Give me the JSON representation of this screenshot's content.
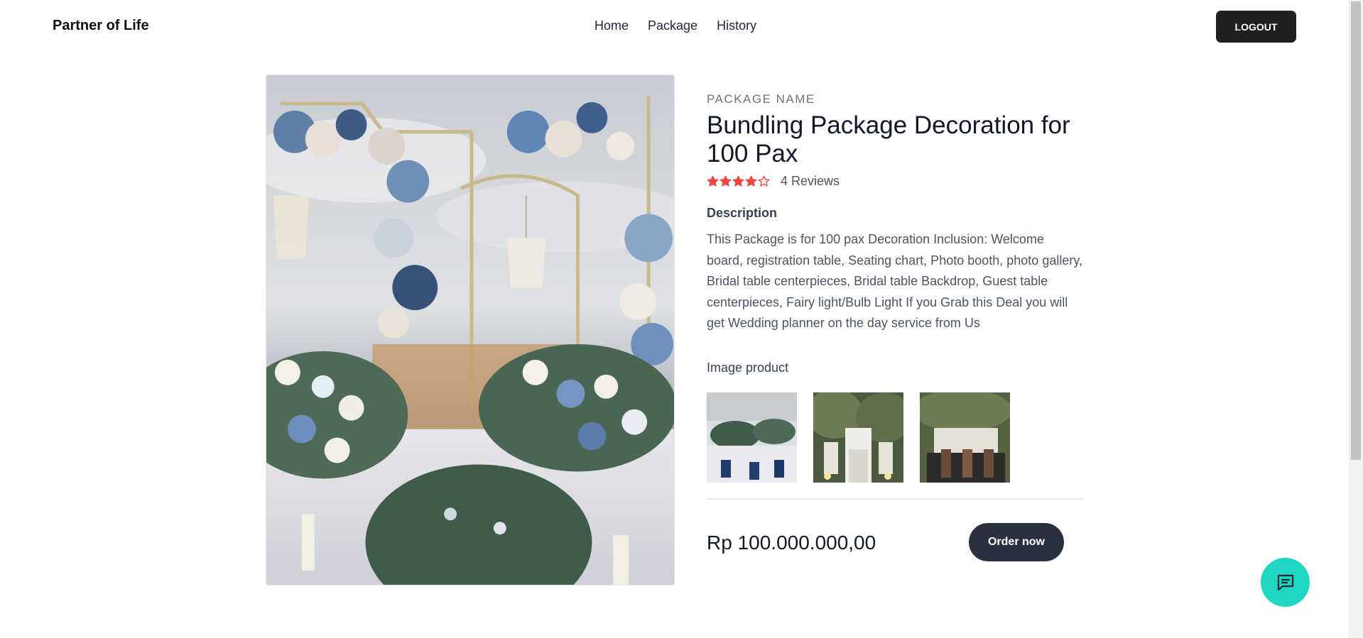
{
  "header": {
    "brand": "Partner of Life",
    "nav": [
      "Home",
      "Package",
      "History"
    ],
    "logout_label": "LOGOUT"
  },
  "product": {
    "label": "PACKAGE NAME",
    "title": "Bundling Package Decoration for 100 Pax",
    "rating": 4,
    "rating_max": 5,
    "reviews": "4 Reviews",
    "description_heading": "Description",
    "description": "This Package is for 100 pax Decoration Inclusion: Welcome board, registration table, Seating chart, Photo booth, photo gallery, Bridal table centerpieces, Bridal table Backdrop, Guest table centerpieces, Fairy light/Bulb Light If you Grab this Deal you will get Wedding planner on the day service from Us",
    "images_label": "Image product",
    "price": "Rp 100.000.000,00",
    "order_label": "Order now"
  },
  "colors": {
    "star": "#ef4444",
    "order_button": "#2b3040",
    "chat_fab": "#1ed6c1",
    "logout_button": "#1f1f1f"
  },
  "icons": {
    "chat": "chat-bubble-icon",
    "star_filled": "star-filled-icon",
    "star_empty": "star-outline-icon"
  }
}
